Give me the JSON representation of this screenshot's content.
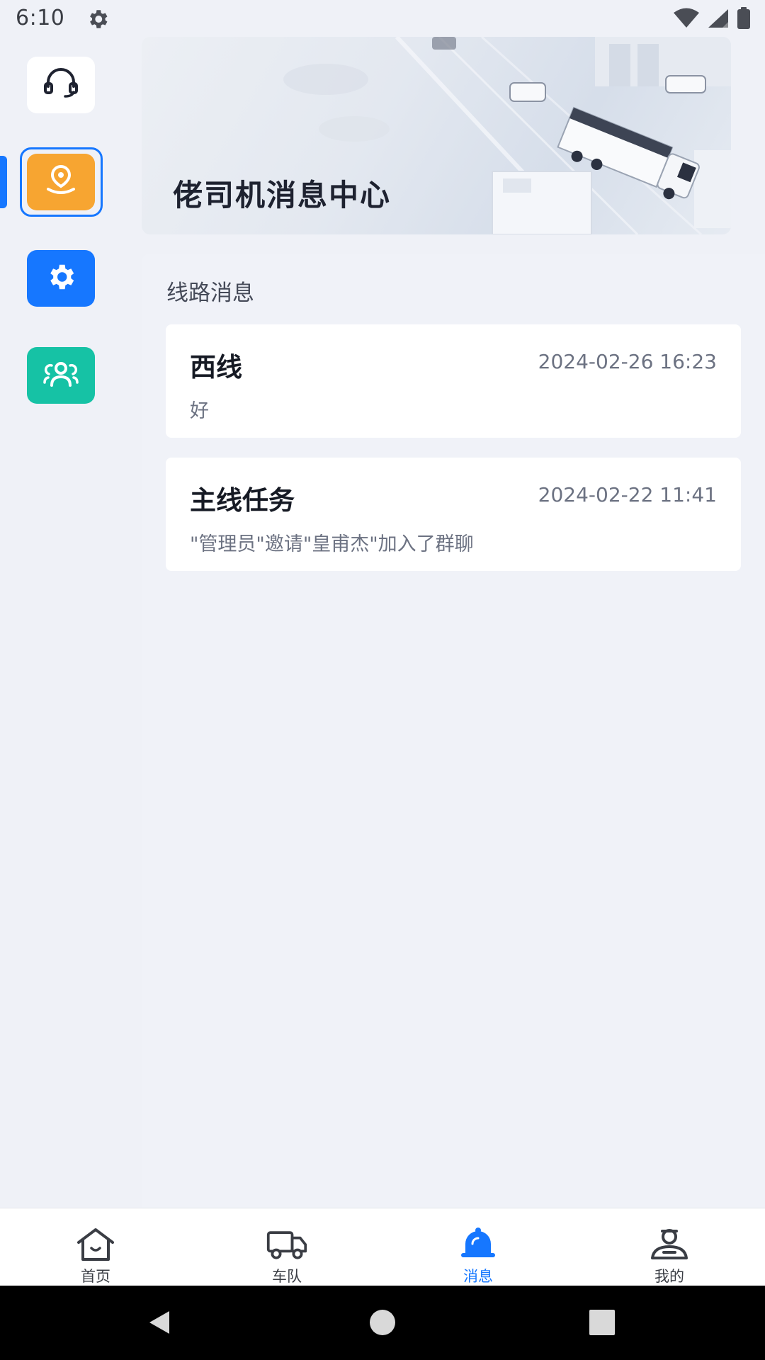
{
  "status_bar": {
    "time": "6:10"
  },
  "sidebar": {
    "items": [
      {
        "name": "support",
        "icon": "headset-icon",
        "color": "#ffffff"
      },
      {
        "name": "location",
        "icon": "location-pin-icon",
        "color": "#f7a531",
        "active": true
      },
      {
        "name": "settings",
        "icon": "gear-icon",
        "color": "#1677ff"
      },
      {
        "name": "team",
        "icon": "group-icon",
        "color": "#16c2a5"
      }
    ]
  },
  "banner": {
    "title": "佬司机消息中心"
  },
  "messages": {
    "section_title": "线路消息",
    "items": [
      {
        "title": "西线",
        "time": "2024-02-26 16:23",
        "body": "好"
      },
      {
        "title": "主线任务",
        "time": "2024-02-22 11:41",
        "body": "\"管理员\"邀请\"皇甫杰\"加入了群聊"
      }
    ]
  },
  "tabbar": {
    "tabs": [
      {
        "label": "首页",
        "icon": "home-icon"
      },
      {
        "label": "车队",
        "icon": "truck-icon"
      },
      {
        "label": "消息",
        "icon": "bell-icon",
        "active": true
      },
      {
        "label": "我的",
        "icon": "profile-icon"
      }
    ]
  },
  "colors": {
    "accent": "#1677ff",
    "orange": "#f7a531",
    "teal": "#16c2a5",
    "background": "#eff1f7"
  }
}
